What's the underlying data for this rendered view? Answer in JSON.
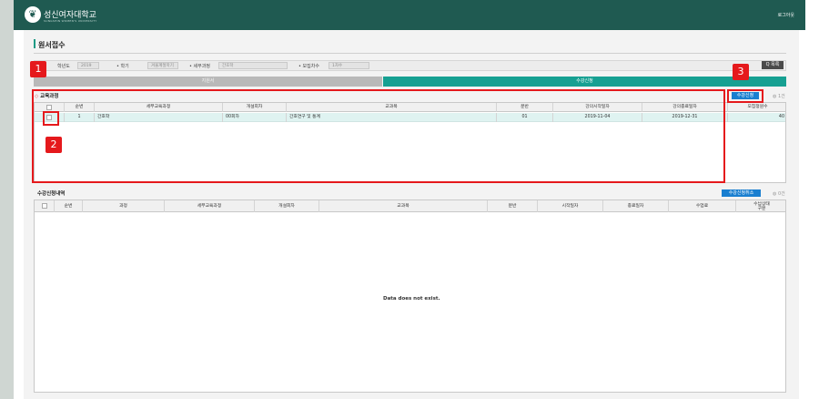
{
  "header": {
    "logo_glyph": "❦",
    "university": "성신여자대학교",
    "subtitle": "SUNGSHIN WOMEN'S UNIVERSITY",
    "logout": "로그아웃"
  },
  "page": {
    "title": "원서접수"
  },
  "filters": {
    "year_label": "학년도",
    "year_value": "2019",
    "term_label": "• 학기",
    "term_value": "겨울계절학기",
    "course_label": "• 세부과정",
    "course_value": "간호학",
    "round_label": "• 모집차수",
    "round_value": "1차수",
    "list_button": "Q 목록"
  },
  "tabs": {
    "left": "지원서",
    "right": "수강신청"
  },
  "course_section": {
    "title": "교육과정",
    "apply_button": "수강신청",
    "count": "1건",
    "columns": [
      "순번",
      "세부교육과정",
      "개설회차",
      "교과목",
      "분반",
      "강의시작일자",
      "강의종료일자",
      "모집정원수"
    ],
    "rows": [
      {
        "no": "1",
        "course": "간호학",
        "session": "00회차",
        "subject": "간호연구 및 통계",
        "section": "01",
        "start": "2019-11-04",
        "end": "2019-12-31",
        "capacity": "40"
      }
    ]
  },
  "apply_section": {
    "title": "수강신청내역",
    "cancel_button": "수강신청취소",
    "count": "0건",
    "columns": [
      "순번",
      "과정",
      "세부교육과정",
      "개설회차",
      "교과목",
      "분반",
      "시작일자",
      "종료일자",
      "수업료",
      "수납상태구분"
    ],
    "empty_message": "Data does not exist."
  },
  "callouts": {
    "one": "1",
    "two": "2",
    "three": "3"
  },
  "colors": {
    "header": "#1f5a51",
    "accent": "#16a092",
    "callout": "#e5191c",
    "button": "#1a7fd0"
  }
}
